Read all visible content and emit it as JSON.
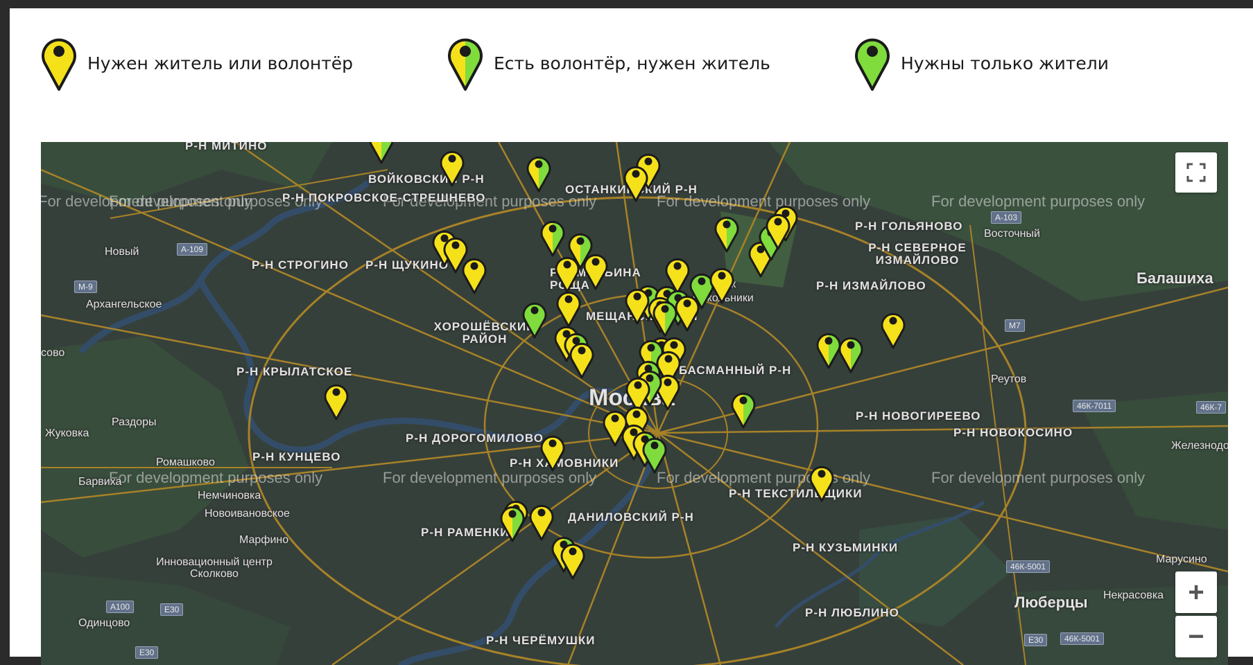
{
  "legend": {
    "items": [
      {
        "label": "Нужен житель или волонтёр",
        "type": "yellow"
      },
      {
        "label": "Есть волонтёр, нужен житель",
        "type": "half"
      },
      {
        "label": "Нужны только жители",
        "type": "green"
      }
    ]
  },
  "colors": {
    "yellow": "#f5e11a",
    "green": "#7fdc3c",
    "pin_outline": "#1b1b1b",
    "map_background": "#3d4a43",
    "road": "#c79a2a"
  },
  "map": {
    "watermark": "For development purposes only",
    "labels": {
      "mitino": "Р-Н МИТИНО",
      "voikovsky": "ВОЙКОВСКИЙ Р-Н",
      "pokrovskoe": "Р-Н ПОКРОВСКОЕ-СТРЕШНЕВО",
      "ostankino": "ОСТАНКИНСКИЙ Р-Н",
      "golyanovo": "Р-Н ГОЛЬЯНОВО",
      "vostochny": "Восточный",
      "novy": "Новый",
      "strogino": "Р-Н СТРОГИНО",
      "shchukino": "Р-Н ЩУКИНО",
      "severnoe_izm": "Р-Н СЕВЕРНОЕ ИЗМАЙЛОВО",
      "izmailovo": "Р-Н ИЗМАЙЛОВО",
      "balashikha": "Балашиха",
      "arkhangelskoe": "Архангельское",
      "maryina_roshcha": "Р-Н МАРЬИНА РОЩА",
      "meshchansky": "МЕЩАНСКИЙ Р-Н",
      "sokolniki": "Парк Сокольники",
      "khoroshevsky": "ХОРОШЁВСКИЙ РАЙОН",
      "krylatskoe": "Р-Н КРЫЛАТСКОЕ",
      "basmanny": "БАСМАННЫЙ Р-Н",
      "reutov": "Реутов",
      "moscow": "Москва",
      "novogireevo": "Р-Н НОВОГИРЕЕВО",
      "novokosino": "Р-Н НОВОКОСИНО",
      "zhukovka": "Жуковка",
      "razdory": "Раздоры",
      "dorogomilovo": "Р-Н ДОРОГОМИЛОВО",
      "kuntsevo": "Р-Н КУНЦЕВО",
      "romashkovo": "Ромашково",
      "barvikha": "Барвиха",
      "zheleznodorozhny": "Железнодорожный",
      "khamovniki": "Р-Н ХАМОВНИКИ",
      "nemchinovka": "Немчиновка",
      "novoivanovskoe": "Новоивановское",
      "tekstilshchiki": "Р-Н ТЕКСТИЛЬЩИКИ",
      "danilovsky": "ДАНИЛОВСКИЙ Р-Н",
      "ramenki": "Р-Н РАМЕНКИ",
      "marfino": "Марфино",
      "kuzminki": "Р-Н КУЗЬМИНКИ",
      "marusino": "Марусино",
      "skolkovo": "Инновационный центр Сколково",
      "lyubertsy": "Люберцы",
      "nekrasovka": "Некрасовка",
      "lyublino": "Р-Н ЛЮБЛИНО",
      "odintsovo": "Одинцово",
      "cheryomushki": "Р-Н ЧЕРЁМУШКИ",
      "sovo": "сово"
    },
    "shields": [
      "А-109",
      "М-9",
      "А-103",
      "М7",
      "46К-7011",
      "46К-7",
      "46К-5001",
      "46К-5001",
      "Е30",
      "А100",
      "Е30",
      "Е30"
    ],
    "pins": [
      {
        "type": "half"
      },
      {
        "type": "yellow"
      },
      {
        "type": "half"
      },
      {
        "type": "yellow"
      },
      {
        "type": "yellow"
      },
      {
        "type": "half"
      },
      {
        "type": "yellow"
      },
      {
        "type": "yellow"
      },
      {
        "type": "yellow"
      },
      {
        "type": "yellow"
      },
      {
        "type": "half"
      },
      {
        "type": "yellow"
      },
      {
        "type": "yellow"
      },
      {
        "type": "half"
      },
      {
        "type": "yellow"
      },
      {
        "type": "yellow"
      },
      {
        "type": "green"
      },
      {
        "type": "yellow"
      },
      {
        "type": "green"
      },
      {
        "type": "yellow"
      },
      {
        "type": "half"
      },
      {
        "type": "yellow"
      },
      {
        "type": "half"
      },
      {
        "type": "green"
      },
      {
        "type": "yellow"
      },
      {
        "type": "yellow"
      },
      {
        "type": "half"
      },
      {
        "type": "yellow"
      },
      {
        "type": "green"
      },
      {
        "type": "yellow"
      },
      {
        "type": "half"
      },
      {
        "type": "yellow"
      },
      {
        "type": "yellow"
      },
      {
        "type": "half"
      },
      {
        "type": "yellow"
      },
      {
        "type": "yellow"
      },
      {
        "type": "yellow"
      },
      {
        "type": "half"
      },
      {
        "type": "half"
      },
      {
        "type": "yellow"
      },
      {
        "type": "yellow"
      },
      {
        "type": "yellow"
      },
      {
        "type": "yellow"
      },
      {
        "type": "half"
      },
      {
        "type": "green"
      },
      {
        "type": "yellow"
      },
      {
        "type": "yellow"
      },
      {
        "type": "half"
      },
      {
        "type": "yellow"
      },
      {
        "type": "half"
      },
      {
        "type": "yellow"
      },
      {
        "type": "yellow"
      },
      {
        "type": "half"
      }
    ]
  },
  "controls": {
    "fullscreen_icon": "fullscreen-icon",
    "zoom_in": "+",
    "zoom_out": "−"
  }
}
